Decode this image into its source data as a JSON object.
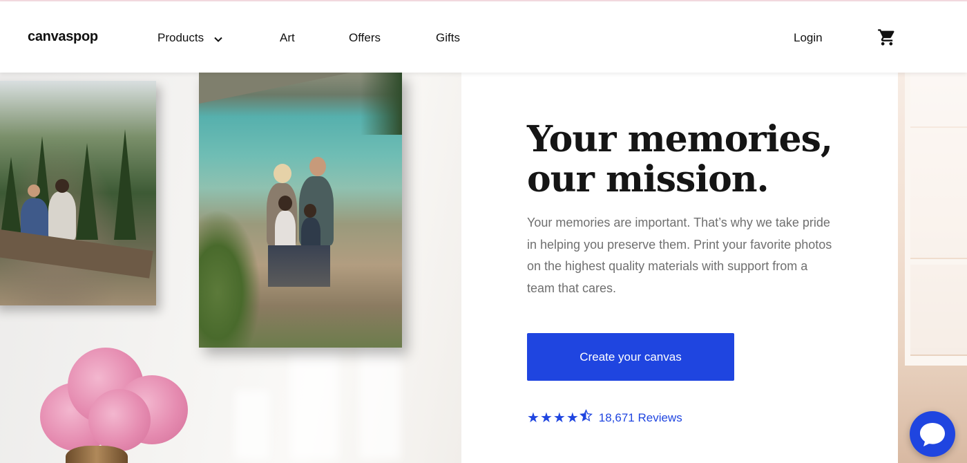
{
  "header": {
    "logo": "canvaspop",
    "nav": [
      {
        "label": "Products",
        "has_dropdown": true
      },
      {
        "label": "Art"
      },
      {
        "label": "Offers"
      },
      {
        "label": "Gifts"
      }
    ],
    "login_label": "Login",
    "cart_icon": "shopping-cart-icon"
  },
  "hero": {
    "title": "Your memories, our mission.",
    "body": "Your memories are important. That’s why we take pride in helping you preserve them. Print your favorite photos on the highest quality materials with support from a team that cares.",
    "cta_label": "Create your canvas",
    "rating": {
      "stars": 4.5,
      "reviews_label": "18,671 Reviews"
    }
  },
  "chat": {
    "icon": "chat-bubble-icon"
  },
  "colors": {
    "accent": "#1f45e0",
    "text": "#151515",
    "muted_text": "#6f6f6f"
  }
}
